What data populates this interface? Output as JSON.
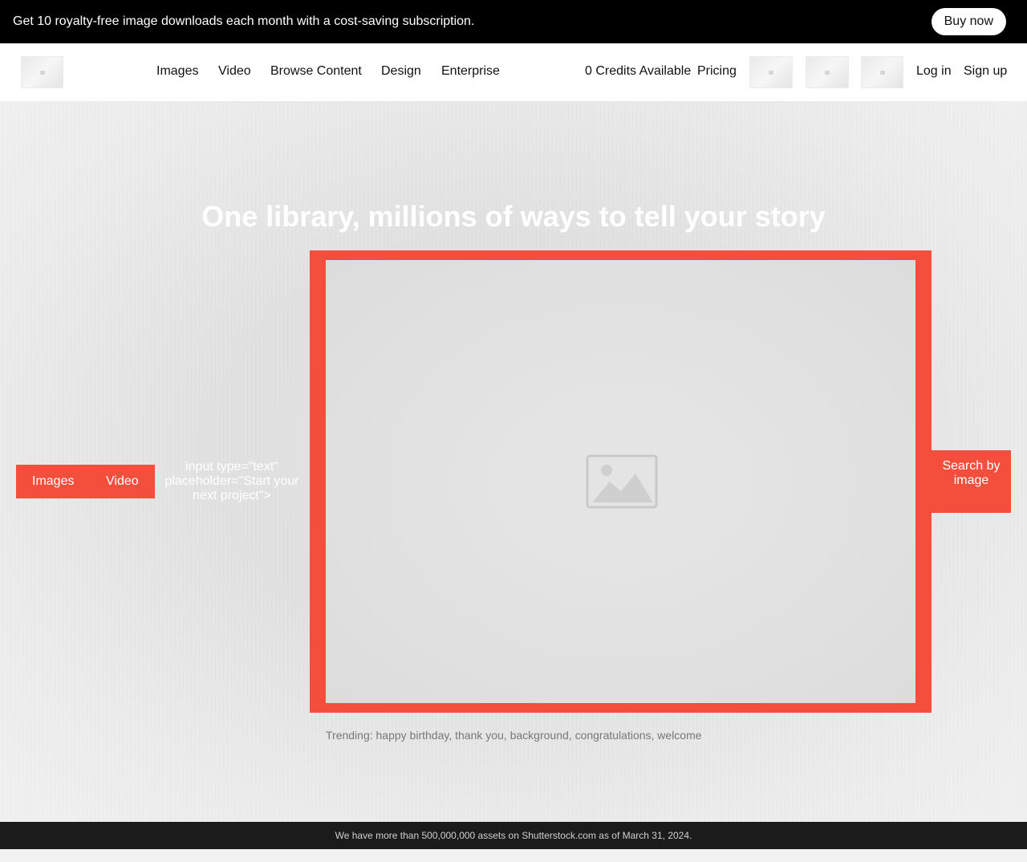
{
  "promo": {
    "text": "Get 10 royalty-free image downloads each month with a cost-saving subscription.",
    "button": "Buy now"
  },
  "header": {
    "nav": [
      "Images",
      "Video",
      "Browse Content",
      "Design",
      "Enterprise"
    ],
    "credits": "0 Credits Available",
    "pricing": "Pricing",
    "login": "Log in",
    "signup": "Sign up"
  },
  "hero": {
    "title": "One library, millions of ways to tell your story",
    "tabs": [
      "Images",
      "Video"
    ],
    "input_markup": "input type=\"text\" placeholder=\"Start your next project\">",
    "search_by_image": "Search by image",
    "trending_label": "Trending:",
    "trending": [
      "happy birthday",
      "thank you",
      "background",
      "congratulations",
      "welcome"
    ]
  },
  "footer": {
    "text": "We have more than 500,000,000 assets on Shutterstock.com as of March 31, 2024."
  },
  "colors": {
    "accent": "#f44f3d",
    "promo_bg": "#000000",
    "footer_bg": "#1b1b1b"
  }
}
